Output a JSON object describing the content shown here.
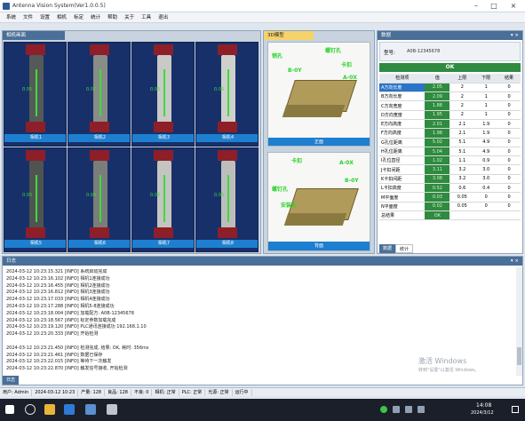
{
  "window": {
    "title": "Antenna Vision System(Ver1.0.0.5)"
  },
  "menu": [
    "系统",
    "文件",
    "设置",
    "相机",
    "标定",
    "统计",
    "帮助",
    "关于",
    "工具",
    "退出"
  ],
  "panels": {
    "cameras": {
      "title": "相机画面"
    },
    "photos": {
      "title": "3D模型"
    },
    "data": {
      "title": "数据",
      "header_label": "型号:",
      "header_value": "A0B-12345678",
      "result": "OK"
    },
    "log": {
      "title": "日志"
    }
  },
  "camera_labels": [
    "相机1",
    "相机2",
    "相机3",
    "相机4",
    "相机5",
    "相机6",
    "相机7",
    "相机8"
  ],
  "camera_values": [
    "0.05",
    "0.07",
    "0.05",
    "0.06",
    "0.05",
    "0.04",
    "0.06",
    "0.05"
  ],
  "photo1": {
    "label": "正面",
    "annotations": [
      "螺钉孔",
      "销孔",
      "卡扣",
      "A-0X",
      "B-0Y"
    ]
  },
  "photo2": {
    "label": "背面",
    "annotations": [
      "卡扣",
      "A-0X",
      "螺钉孔",
      "安装孔",
      "B-0Y"
    ]
  },
  "data_table": {
    "headers": [
      "检测项",
      "值",
      "上限",
      "下限",
      "结果"
    ],
    "rows": [
      [
        "A方向长度",
        "2.05",
        "2",
        "1",
        "0"
      ],
      [
        "B方向长度",
        "2.09",
        "2",
        "1",
        "0"
      ],
      [
        "C方向宽度",
        "1.88",
        "2",
        "1",
        "0"
      ],
      [
        "D方向宽度",
        "1.95",
        "2",
        "1",
        "0"
      ],
      [
        "E方向高度",
        "2.01",
        "2.1",
        "1.9",
        "0"
      ],
      [
        "F方向高度",
        "1.98",
        "2.1",
        "1.9",
        "0"
      ],
      [
        "G孔位距离",
        "5.02",
        "5.1",
        "4.9",
        "0"
      ],
      [
        "H孔位距离",
        "5.04",
        "5.1",
        "4.9",
        "0"
      ],
      [
        "I孔位直径",
        "1.02",
        "1.1",
        "0.9",
        "0"
      ],
      [
        "J卡扣间距",
        "3.11",
        "3.2",
        "3.0",
        "0"
      ],
      [
        "K卡扣间距",
        "3.08",
        "3.2",
        "3.0",
        "0"
      ],
      [
        "L卡扣高度",
        "0.52",
        "0.6",
        "0.4",
        "0"
      ],
      [
        "M平面度",
        "0.03",
        "0.05",
        "0",
        "0"
      ],
      [
        "N平面度",
        "0.02",
        "0.05",
        "0",
        "0"
      ],
      [
        "总结果",
        "OK",
        "",
        "",
        ""
      ]
    ],
    "tabs": [
      "数据",
      "统计"
    ]
  },
  "log": [
    "2024-03-12 10:23:15.321 [INFO] 系统启动完成",
    "2024-03-12 10:23:16.102 [INFO] 相机1连接成功",
    "2024-03-12 10:23:16.455 [INFO] 相机2连接成功",
    "2024-03-12 10:23:16.812 [INFO] 相机3连接成功",
    "2024-03-12 10:23:17.033 [INFO] 相机4连接成功",
    "2024-03-12 10:23:17.288 [INFO] 相机5-8连接成功",
    "2024-03-12 10:23:18.004 [INFO] 加载配方: A0B-12345678",
    "2024-03-12 10:23:18.567 [INFO] 标定参数加载完成",
    "2024-03-12 10:23:19.120 [INFO] PLC通讯连接成功 192.168.1.10",
    "2024-03-12 10:23:20.333 [INFO] 开始检测",
    "",
    "2024-03-12 10:23:21.450 [INFO] 检测完成, 结果: OK, 耗时: 356ms",
    "2024-03-12 10:23:21.461 [INFO] 数据已保存",
    "2024-03-12 10:23:22.015 [INFO] 等待下一次触发",
    "2024-03-12 10:23:22.870 [INFO] 触发信号接收, 开始检测"
  ],
  "watermark": {
    "line1": "激活 Windows",
    "line2": "转到\"设置\"以激活 Windows。"
  },
  "status": [
    "用户: Admin",
    "2024-03-12 10:23",
    "产量: 128",
    "良品: 128",
    "不良: 0",
    "相机: 正常",
    "PLC: 正常",
    "光源: 正常",
    "运行中"
  ],
  "taskbar": {
    "time": "14:08",
    "date": "2024/3/12"
  }
}
